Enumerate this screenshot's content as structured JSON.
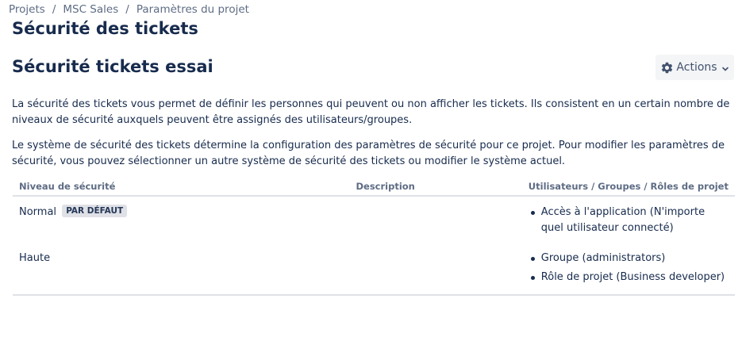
{
  "breadcrumb": {
    "items": [
      "Projets",
      "MSC Sales",
      "Paramètres du projet"
    ],
    "separator": "/"
  },
  "page": {
    "title": "Sécurité des tickets"
  },
  "scheme": {
    "title": "Sécurité tickets essai",
    "actions_label": "Actions",
    "actions_icon": "gear-icon",
    "actions_dropdown_icon": "chevron-down-icon"
  },
  "description": {
    "paragraph_1": "La sécurité des tickets vous permet de définir les personnes qui peuvent ou non afficher les tickets. Ils consistent en un certain nombre de niveaux de sécurité auxquels peuvent être assignés des utilisateurs/groupes.",
    "paragraph_2": "Le système de sécurité des tickets détermine la configuration des paramètres de sécurité pour ce projet. Pour modifier les paramètres de sécurité, vous pouvez sélectionner un autre système de sécurité des tickets ou modifier le système actuel."
  },
  "table": {
    "headers": {
      "level": "Niveau de sécurité",
      "description": "Description",
      "users": "Utilisateurs / Groupes / Rôles de projet"
    },
    "rows": [
      {
        "level": "Normal",
        "badge": "PAR DÉFAUT",
        "description": "",
        "users": [
          "Accès à l'application (N'importe quel utilisateur connecté)"
        ]
      },
      {
        "level": "Haute",
        "badge": "",
        "description": "",
        "users": [
          "Groupe (administrators)",
          "Rôle de projet (Business developer)"
        ]
      }
    ]
  },
  "colors": {
    "text": "#172b4d",
    "muted": "#5e6c84",
    "button_bg": "#f4f5f7",
    "badge_bg": "#dfe1e6",
    "border": "#dfe1e6"
  }
}
